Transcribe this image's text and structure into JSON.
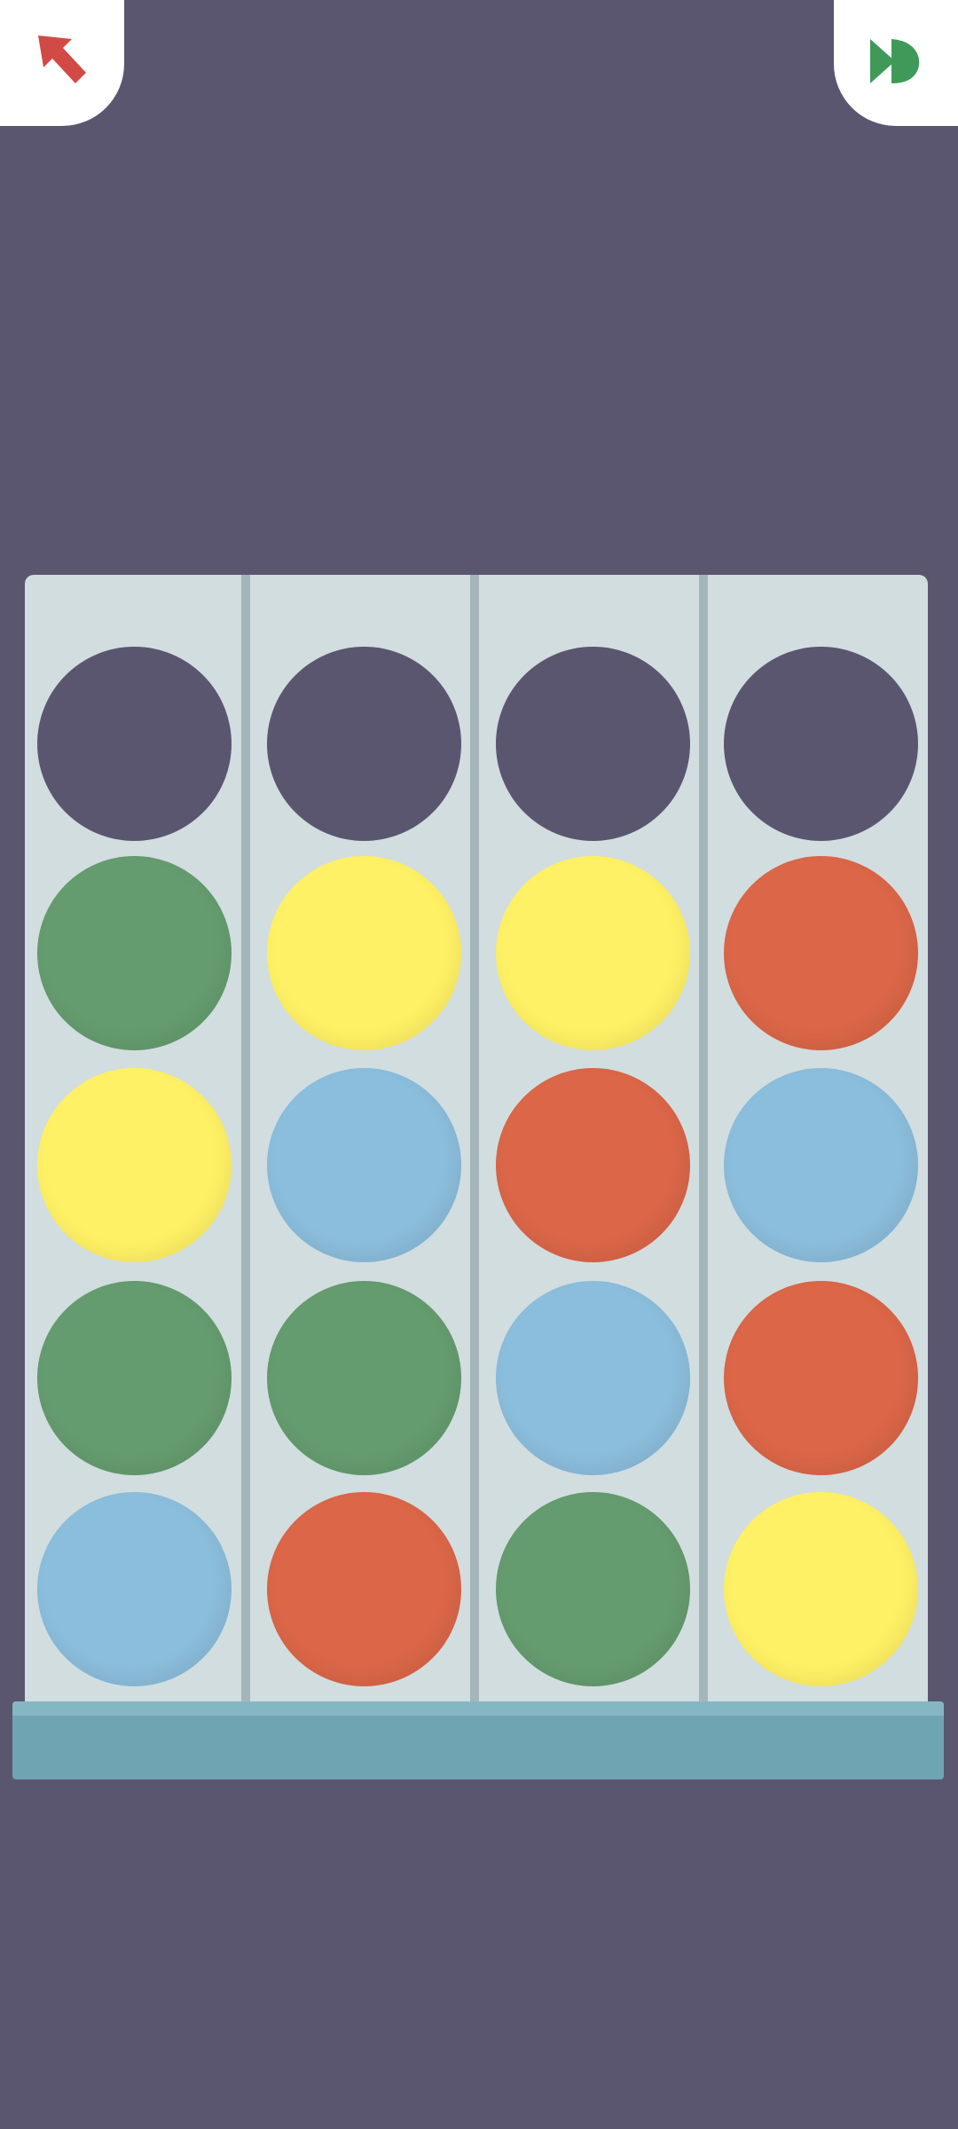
{
  "toolbar": {
    "back_icon": "back-arrow-icon",
    "back_color": "#d24a45",
    "skip_icon": "fast-forward-icon",
    "skip_color": "#3f9a5a"
  },
  "palette": {
    "empty": "#5b5670",
    "green": "#659c6f",
    "yellow": "#fff165",
    "red": "#db6648",
    "blue": "#8bbddc"
  },
  "board": {
    "rows": [
      [
        "empty",
        "empty",
        "empty",
        "empty"
      ],
      [
        "green",
        "yellow",
        "yellow",
        "red"
      ],
      [
        "yellow",
        "blue",
        "red",
        "blue"
      ],
      [
        "green",
        "green",
        "blue",
        "red"
      ],
      [
        "blue",
        "red",
        "green",
        "yellow"
      ]
    ]
  }
}
